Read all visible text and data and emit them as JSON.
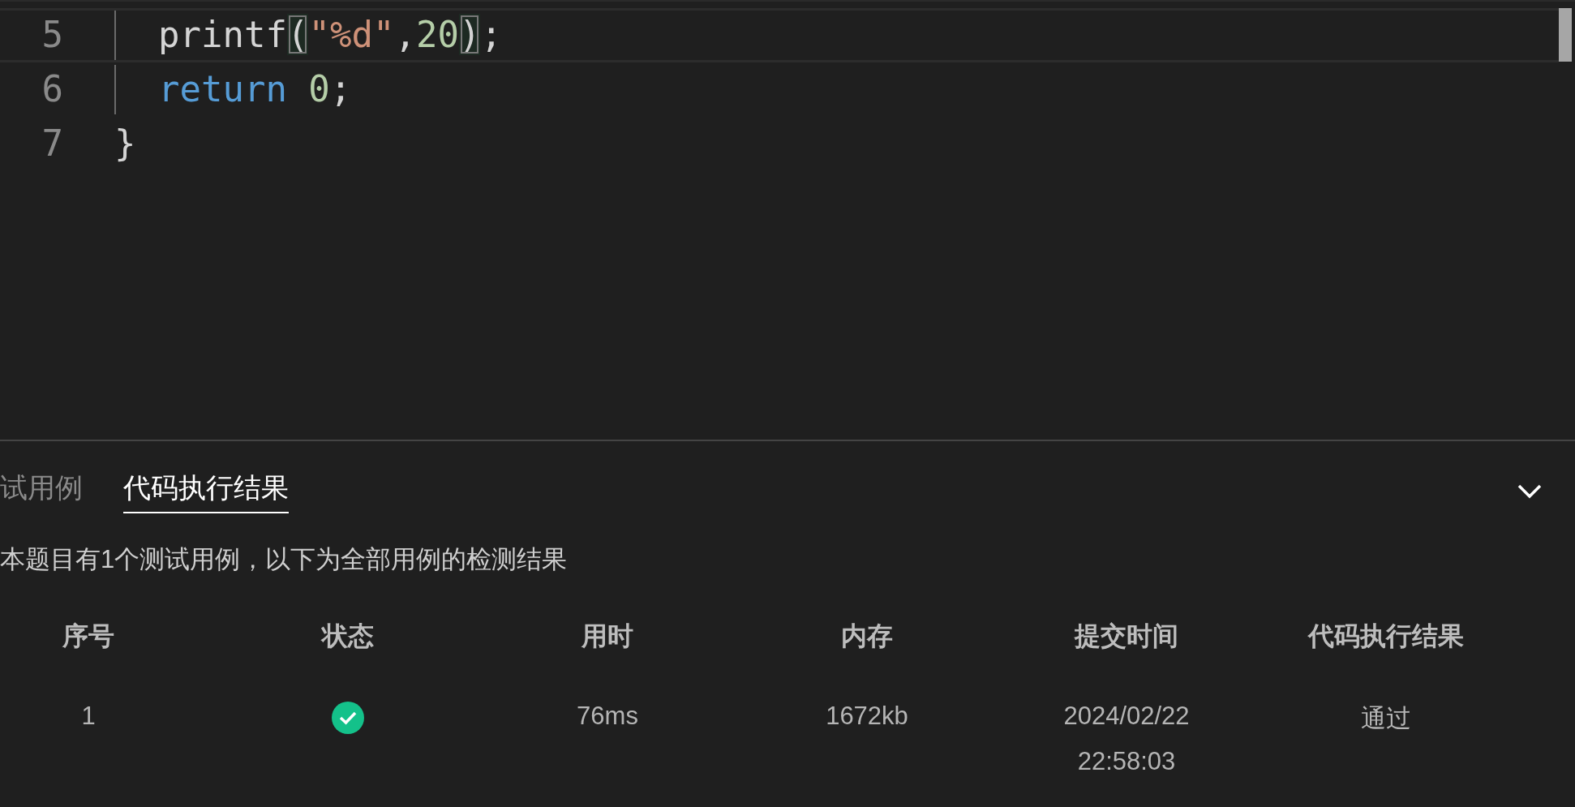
{
  "editor": {
    "lines": [
      {
        "number": "5",
        "current": true,
        "indent": true,
        "tokens": [
          {
            "text": "printf",
            "kind": "plain"
          },
          {
            "text": "(",
            "kind": "bracket"
          },
          {
            "text": "\"%d\"",
            "kind": "string"
          },
          {
            "text": ",",
            "kind": "plain"
          },
          {
            "text": "20",
            "kind": "number"
          },
          {
            "text": ")",
            "kind": "bracket"
          },
          {
            "text": ";",
            "kind": "plain"
          }
        ]
      },
      {
        "number": "6",
        "current": false,
        "indent": true,
        "tokens": [
          {
            "text": "return",
            "kind": "keyword"
          },
          {
            "text": "0",
            "kind": "number",
            "space_before": true
          },
          {
            "text": ";",
            "kind": "plain"
          }
        ]
      },
      {
        "number": "7",
        "current": false,
        "indent": false,
        "tokens": [
          {
            "text": "}",
            "kind": "plain"
          }
        ]
      }
    ]
  },
  "panel": {
    "tabs": [
      {
        "label": "试用例",
        "selected": false
      },
      {
        "label": "代码执行结果",
        "selected": true
      }
    ],
    "summary": "本题目有1个测试用例，以下为全部用例的检测结果",
    "table": {
      "columns": [
        "序号",
        "状态",
        "用时",
        "内存",
        "提交时间",
        "代码执行结果"
      ],
      "rows": [
        {
          "index": "1",
          "passed": true,
          "time": "76ms",
          "memory": "1672kb",
          "submitted": [
            "2024/02/22",
            "22:58:03"
          ],
          "result": "通过"
        }
      ]
    }
  }
}
